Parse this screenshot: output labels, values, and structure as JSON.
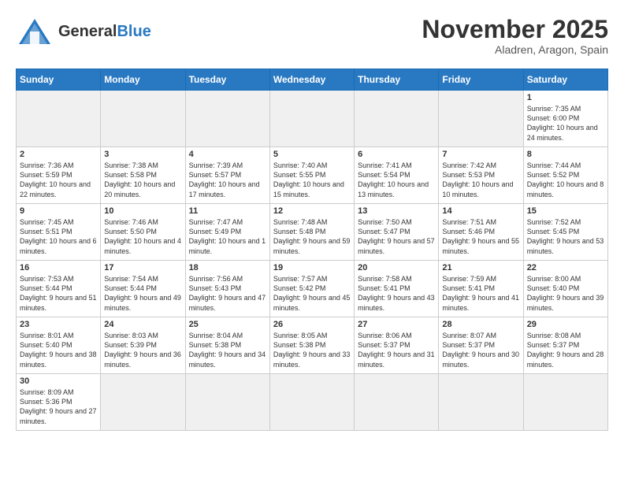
{
  "header": {
    "logo_general": "General",
    "logo_blue": "Blue",
    "month_title": "November 2025",
    "subtitle": "Aladren, Aragon, Spain"
  },
  "days_of_week": [
    "Sunday",
    "Monday",
    "Tuesday",
    "Wednesday",
    "Thursday",
    "Friday",
    "Saturday"
  ],
  "weeks": [
    [
      {
        "day": "",
        "info": ""
      },
      {
        "day": "",
        "info": ""
      },
      {
        "day": "",
        "info": ""
      },
      {
        "day": "",
        "info": ""
      },
      {
        "day": "",
        "info": ""
      },
      {
        "day": "",
        "info": ""
      },
      {
        "day": "1",
        "info": "Sunrise: 7:35 AM\nSunset: 6:00 PM\nDaylight: 10 hours and 24 minutes."
      }
    ],
    [
      {
        "day": "2",
        "info": "Sunrise: 7:36 AM\nSunset: 5:59 PM\nDaylight: 10 hours and 22 minutes."
      },
      {
        "day": "3",
        "info": "Sunrise: 7:38 AM\nSunset: 5:58 PM\nDaylight: 10 hours and 20 minutes."
      },
      {
        "day": "4",
        "info": "Sunrise: 7:39 AM\nSunset: 5:57 PM\nDaylight: 10 hours and 17 minutes."
      },
      {
        "day": "5",
        "info": "Sunrise: 7:40 AM\nSunset: 5:55 PM\nDaylight: 10 hours and 15 minutes."
      },
      {
        "day": "6",
        "info": "Sunrise: 7:41 AM\nSunset: 5:54 PM\nDaylight: 10 hours and 13 minutes."
      },
      {
        "day": "7",
        "info": "Sunrise: 7:42 AM\nSunset: 5:53 PM\nDaylight: 10 hours and 10 minutes."
      },
      {
        "day": "8",
        "info": "Sunrise: 7:44 AM\nSunset: 5:52 PM\nDaylight: 10 hours and 8 minutes."
      }
    ],
    [
      {
        "day": "9",
        "info": "Sunrise: 7:45 AM\nSunset: 5:51 PM\nDaylight: 10 hours and 6 minutes."
      },
      {
        "day": "10",
        "info": "Sunrise: 7:46 AM\nSunset: 5:50 PM\nDaylight: 10 hours and 4 minutes."
      },
      {
        "day": "11",
        "info": "Sunrise: 7:47 AM\nSunset: 5:49 PM\nDaylight: 10 hours and 1 minute."
      },
      {
        "day": "12",
        "info": "Sunrise: 7:48 AM\nSunset: 5:48 PM\nDaylight: 9 hours and 59 minutes."
      },
      {
        "day": "13",
        "info": "Sunrise: 7:50 AM\nSunset: 5:47 PM\nDaylight: 9 hours and 57 minutes."
      },
      {
        "day": "14",
        "info": "Sunrise: 7:51 AM\nSunset: 5:46 PM\nDaylight: 9 hours and 55 minutes."
      },
      {
        "day": "15",
        "info": "Sunrise: 7:52 AM\nSunset: 5:45 PM\nDaylight: 9 hours and 53 minutes."
      }
    ],
    [
      {
        "day": "16",
        "info": "Sunrise: 7:53 AM\nSunset: 5:44 PM\nDaylight: 9 hours and 51 minutes."
      },
      {
        "day": "17",
        "info": "Sunrise: 7:54 AM\nSunset: 5:44 PM\nDaylight: 9 hours and 49 minutes."
      },
      {
        "day": "18",
        "info": "Sunrise: 7:56 AM\nSunset: 5:43 PM\nDaylight: 9 hours and 47 minutes."
      },
      {
        "day": "19",
        "info": "Sunrise: 7:57 AM\nSunset: 5:42 PM\nDaylight: 9 hours and 45 minutes."
      },
      {
        "day": "20",
        "info": "Sunrise: 7:58 AM\nSunset: 5:41 PM\nDaylight: 9 hours and 43 minutes."
      },
      {
        "day": "21",
        "info": "Sunrise: 7:59 AM\nSunset: 5:41 PM\nDaylight: 9 hours and 41 minutes."
      },
      {
        "day": "22",
        "info": "Sunrise: 8:00 AM\nSunset: 5:40 PM\nDaylight: 9 hours and 39 minutes."
      }
    ],
    [
      {
        "day": "23",
        "info": "Sunrise: 8:01 AM\nSunset: 5:40 PM\nDaylight: 9 hours and 38 minutes."
      },
      {
        "day": "24",
        "info": "Sunrise: 8:03 AM\nSunset: 5:39 PM\nDaylight: 9 hours and 36 minutes."
      },
      {
        "day": "25",
        "info": "Sunrise: 8:04 AM\nSunset: 5:38 PM\nDaylight: 9 hours and 34 minutes."
      },
      {
        "day": "26",
        "info": "Sunrise: 8:05 AM\nSunset: 5:38 PM\nDaylight: 9 hours and 33 minutes."
      },
      {
        "day": "27",
        "info": "Sunrise: 8:06 AM\nSunset: 5:37 PM\nDaylight: 9 hours and 31 minutes."
      },
      {
        "day": "28",
        "info": "Sunrise: 8:07 AM\nSunset: 5:37 PM\nDaylight: 9 hours and 30 minutes."
      },
      {
        "day": "29",
        "info": "Sunrise: 8:08 AM\nSunset: 5:37 PM\nDaylight: 9 hours and 28 minutes."
      }
    ],
    [
      {
        "day": "30",
        "info": "Sunrise: 8:09 AM\nSunset: 5:36 PM\nDaylight: 9 hours and 27 minutes."
      },
      {
        "day": "",
        "info": ""
      },
      {
        "day": "",
        "info": ""
      },
      {
        "day": "",
        "info": ""
      },
      {
        "day": "",
        "info": ""
      },
      {
        "day": "",
        "info": ""
      },
      {
        "day": "",
        "info": ""
      }
    ]
  ]
}
